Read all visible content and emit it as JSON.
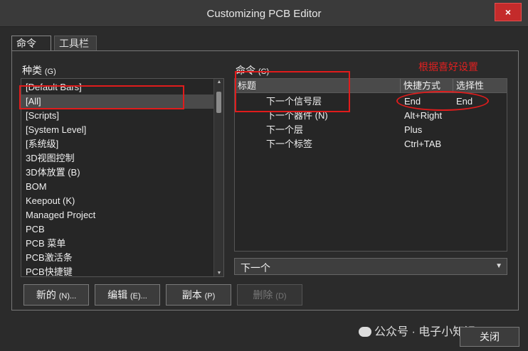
{
  "window": {
    "title": "Customizing PCB Editor",
    "close_glyph": "×"
  },
  "tabs": [
    {
      "label": "命令",
      "active": true
    },
    {
      "label": "工具栏",
      "active": false
    }
  ],
  "categories": {
    "label": "种类",
    "shortcut": "(G)",
    "items": [
      "[Default Bars]",
      "[All]",
      "[Scripts]",
      "[System Level]",
      "[系统级]",
      "3D视图控制",
      "3D体放置 (B)",
      "BOM",
      "Keepout (K)",
      "Managed Project",
      "PCB",
      "PCB 菜单",
      "PCB激活条",
      "PCB快捷键"
    ],
    "selected_index": 1
  },
  "commands": {
    "label": "命令",
    "shortcut": "(C)",
    "columns": [
      "标题",
      "快捷方式",
      "选择性"
    ],
    "rows": [
      {
        "title": "下一个信号层",
        "shortcut": "End",
        "alt": "End"
      },
      {
        "title": "下一个器件 (N)",
        "shortcut": "Alt+Right",
        "alt": ""
      },
      {
        "title": "下一个层",
        "shortcut": "Plus",
        "alt": ""
      },
      {
        "title": "下一个标签",
        "shortcut": "Ctrl+TAB",
        "alt": ""
      }
    ]
  },
  "filter": {
    "value": "下一个"
  },
  "buttons": [
    {
      "label": "新的",
      "shortcut": "(N)...",
      "enabled": true
    },
    {
      "label": "编辑",
      "shortcut": "(E)...",
      "enabled": true
    },
    {
      "label": "副本",
      "shortcut": "(P)",
      "enabled": true
    },
    {
      "label": "删除",
      "shortcut": "(D)",
      "enabled": false
    }
  ],
  "annotation": {
    "text": "根据喜好设置",
    "color": "#e01c1c"
  },
  "footer": {
    "close_label": "关闭",
    "watermark": "公众号 · 电子小知识"
  },
  "colors": {
    "background": "#2b2b2b",
    "selection": "#4a4a4a",
    "annotation": "#e01c1c",
    "close_button": "#c42b2b"
  }
}
